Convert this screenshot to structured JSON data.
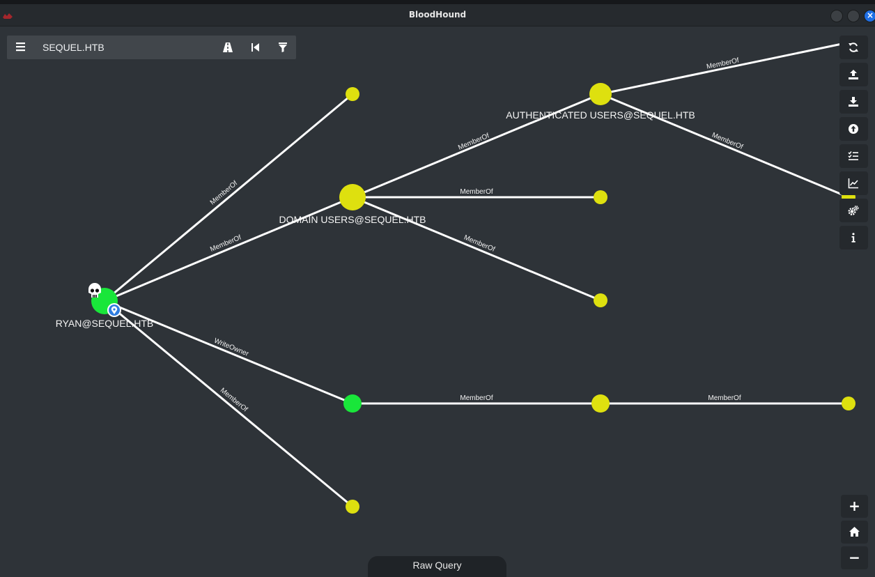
{
  "window": {
    "title": "BloodHound"
  },
  "search": {
    "value": "SEQUEL.HTB"
  },
  "graph": {
    "nodes": {
      "ryan": {
        "label": "RYAN@SEQUEL.HTB",
        "color": "#19e63a",
        "owned": true,
        "icon": "skull-icon"
      },
      "domain_users": {
        "label": "DOMAIN USERS@SEQUEL.HTB",
        "color": "#dee00f"
      },
      "authenticated_users": {
        "label": "AUTHENTICATED USERS@SEQUEL.HTB",
        "color": "#dee00f"
      }
    },
    "edges": {
      "ryan_group_top": "MemberOf",
      "ryan_domain_users": "MemberOf",
      "ryan_writeowner": "WriteOwner",
      "ryan_group_bottom": "MemberOf",
      "du_authenticated": "MemberOf",
      "du_group_mid": "MemberOf",
      "du_group_low": "MemberOf",
      "au_top_right": "MemberOf",
      "au_right": "MemberOf",
      "owned_target_group": "MemberOf",
      "group_right": "MemberOf"
    }
  },
  "toolbar": {
    "buttons": [
      "refresh-icon",
      "upload-icon",
      "download-icon",
      "import-icon",
      "checklist-icon",
      "chart-icon",
      "settings-icon",
      "info-icon"
    ]
  },
  "zoom": {
    "zoom_in": "+",
    "zoom_out": "−"
  },
  "raw_query": {
    "label": "Raw Query"
  },
  "colors": {
    "background": "#2e3338",
    "user_node": "#19e63a",
    "group_node": "#dee00f",
    "edge": "#ffffff"
  }
}
